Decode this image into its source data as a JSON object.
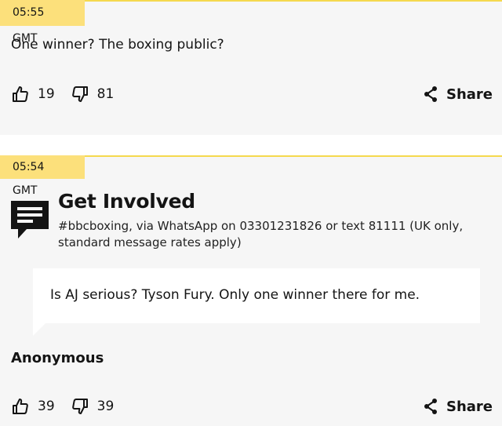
{
  "posts": [
    {
      "timestamp": "05:55 GMT",
      "text": "One winner? The boxing public?",
      "likes": "19",
      "dislikes": "81",
      "share_label": "Share"
    },
    {
      "timestamp": "05:54 GMT",
      "get_involved": {
        "title": "Get Involved",
        "description": "#bbcboxing, via WhatsApp on 03301231826 or text 81111 (UK only, standard message rates apply)"
      },
      "quote": "Is AJ serious? Tyson Fury. Only one winner there for me.",
      "author": "Anonymous",
      "likes": "39",
      "dislikes": "39",
      "share_label": "Share"
    }
  ],
  "colors": {
    "timestamp_bg": "#fce07b",
    "post_bg": "#f6f6f6",
    "text": "#141414"
  },
  "icons": [
    "thumbs-up-icon",
    "thumbs-down-icon",
    "share-icon",
    "speech-bubble-icon"
  ]
}
